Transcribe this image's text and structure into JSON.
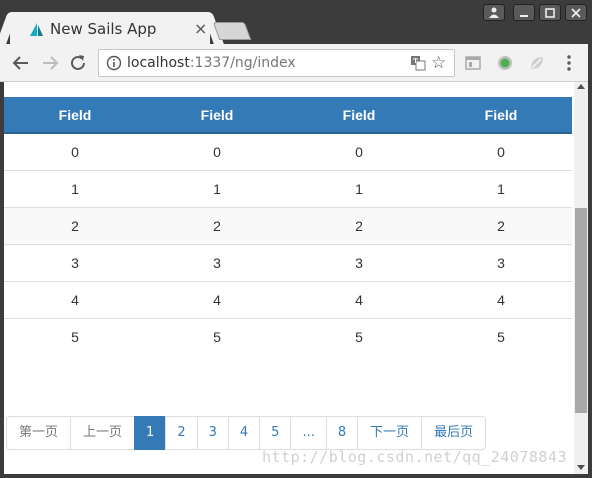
{
  "browser": {
    "tab_title": "New Sails App",
    "tab_close": "×",
    "url_host": "localhost",
    "url_path": ":1337/ng/index",
    "icons": [
      "back-arrow-icon",
      "forward-arrow-icon",
      "reload-icon",
      "info-icon",
      "translate-icon",
      "star-icon",
      "extension-icon",
      "menu-icon"
    ]
  },
  "table": {
    "headers": [
      "Field",
      "Field",
      "Field",
      "Field"
    ],
    "rows": [
      [
        "0",
        "0",
        "0",
        "0"
      ],
      [
        "1",
        "1",
        "1",
        "1"
      ],
      [
        "2",
        "2",
        "2",
        "2"
      ],
      [
        "3",
        "3",
        "3",
        "3"
      ],
      [
        "4",
        "4",
        "4",
        "4"
      ],
      [
        "5",
        "5",
        "5",
        "5"
      ]
    ]
  },
  "pagination": {
    "first": "第一页",
    "prev": "上一页",
    "pages": [
      "1",
      "2",
      "3",
      "4",
      "5",
      "...",
      "8"
    ],
    "active_page": "1",
    "next": "下一页",
    "last": "最后页"
  },
  "watermark": "http://blog.csdn.net/qq_24078843",
  "colors": {
    "header_bg": "#337ab7",
    "link": "#337ab7",
    "titlebar": "#3c3c3c"
  }
}
